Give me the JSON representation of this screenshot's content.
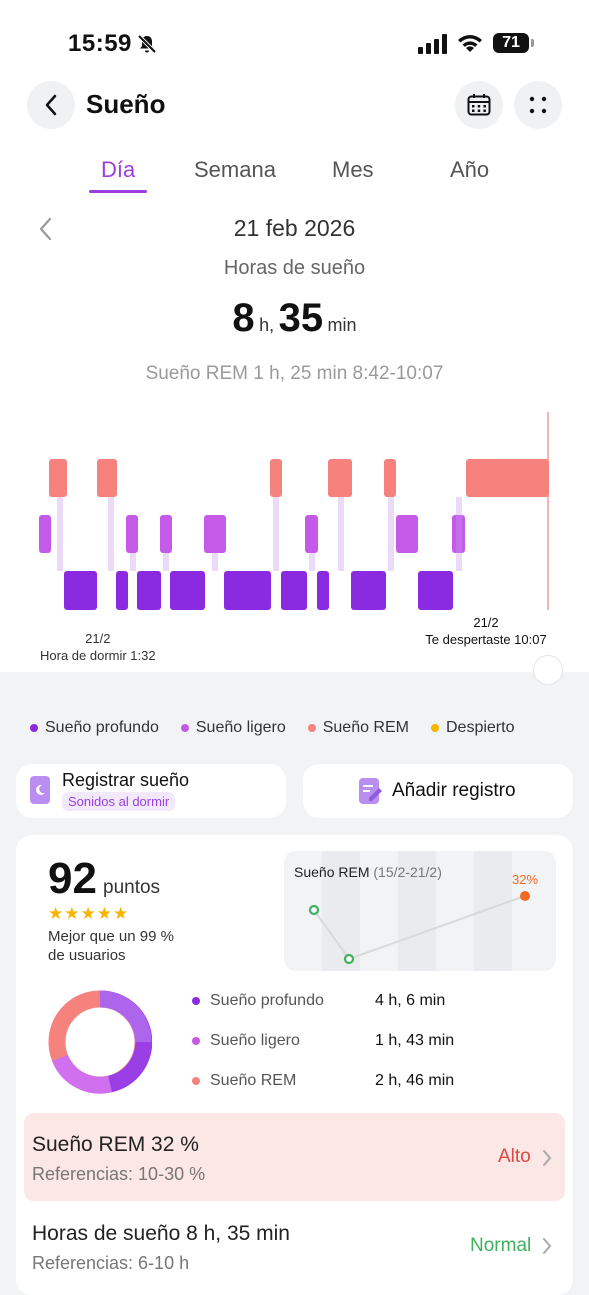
{
  "status": {
    "time": "15:59",
    "battery": "71"
  },
  "header": {
    "title": "Sueño"
  },
  "tabs": [
    {
      "label": "Día",
      "active": true
    },
    {
      "label": "Semana",
      "active": false
    },
    {
      "label": "Mes",
      "active": false
    },
    {
      "label": "Año",
      "active": false
    }
  ],
  "summary": {
    "date": "21 feb 2026",
    "hours_label": "Horas de sueño",
    "hours": "8",
    "hours_unit": "h,",
    "minutes": "35",
    "minutes_unit": "min",
    "selected_segment": "Sueño REM 1 h, 25 min 8:42-10:07"
  },
  "timeline": {
    "start_date": "21/2",
    "start_label": "Hora de dormir 1:32",
    "end_date": "21/2",
    "end_label": "Te despertaste 10:07"
  },
  "legend": [
    {
      "label": "Sueño profundo",
      "color": "#8a2be2"
    },
    {
      "label": "Sueño ligero",
      "color": "#c55ae8"
    },
    {
      "label": "Sueño REM",
      "color": "#f5827d"
    },
    {
      "label": "Despierto",
      "color": "#f7b500"
    }
  ],
  "actions": {
    "register_title": "Registrar sueño",
    "register_chip": "Sonidos al dormir",
    "add_record": "Añadir registro"
  },
  "score": {
    "value": "92",
    "unit": "puntos",
    "stars": "★★★★★",
    "comparison": "Mejor que un 99 %",
    "comparison_2": "de usuarios"
  },
  "rem_trend": {
    "title": "Sueño REM",
    "range": "(15/2-21/2)",
    "last_value": "32%"
  },
  "breakdown": [
    {
      "label": "Sueño profundo",
      "value": "4 h, 6 min",
      "color": "#8a2be2"
    },
    {
      "label": "Sueño ligero",
      "value": "1 h, 43 min",
      "color": "#c55ae8"
    },
    {
      "label": "Sueño REM",
      "value": "2 h, 46 min",
      "color": "#f5827d"
    }
  ],
  "rem_card": {
    "title": "Sueño REM 32 %",
    "ref": "Referencias: 10-30 %",
    "status": "Alto"
  },
  "hours_card": {
    "title": "Horas de sueño 8 h, 35 min",
    "ref": "Referencias: 6-10 h",
    "status": "Normal"
  }
}
